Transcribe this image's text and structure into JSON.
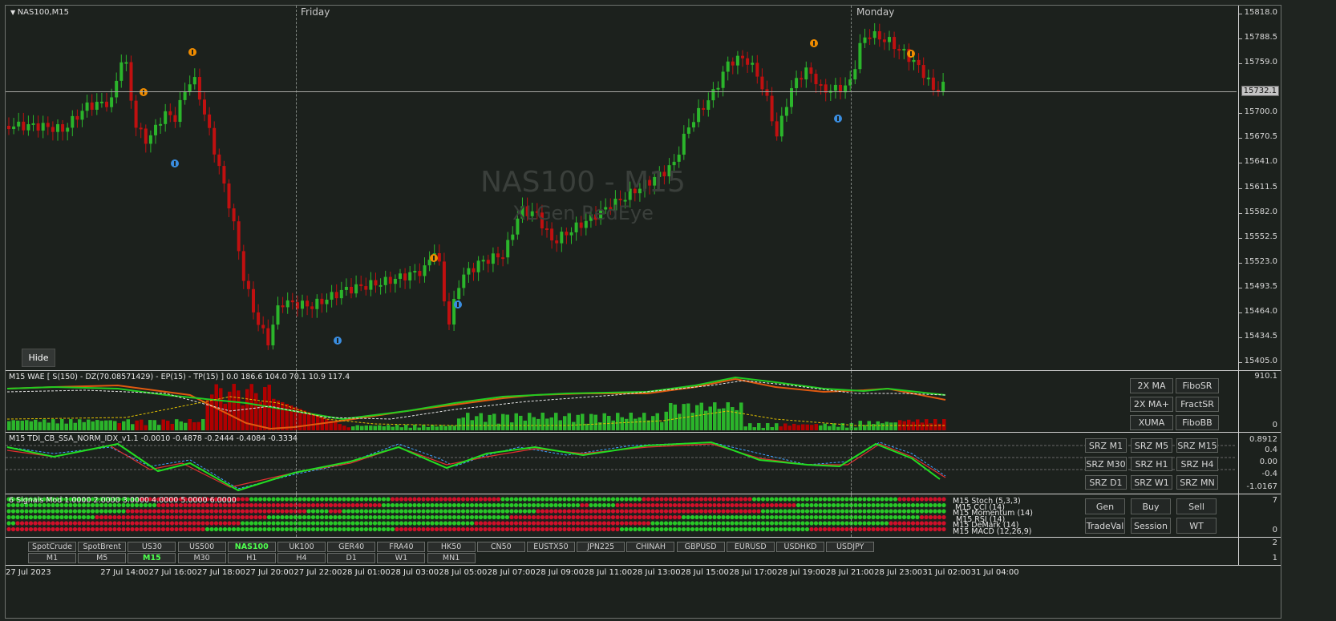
{
  "chart": {
    "symbol": "NAS100,M15",
    "watermark_title": "NAS100 - M15",
    "watermark_sub": "XLGen RedEye",
    "current_price": "15732.1",
    "price_ticks": [
      "15818.0",
      "15788.5",
      "15759.0",
      "15700.0",
      "15670.5",
      "15641.0",
      "15611.5",
      "15582.0",
      "15552.5",
      "15523.0",
      "15493.5",
      "15464.0",
      "15434.5",
      "15405.0"
    ],
    "day_labels": [
      "Friday",
      "Monday"
    ],
    "hide_label": "Hide",
    "colors": {
      "bull": "#2bb52b",
      "bear": "#c01010",
      "background": "#1c211d",
      "arrow_up": "#3a8de0",
      "arrow_down": "#f08c00"
    }
  },
  "wae": {
    "title": "M15 WAE [ S(150) - DZ(70.08571429) - EP(15) - TP(15) ] 0.0 186.6 104.0 70.1 10.9 117.4",
    "axis_top": "910.1",
    "axis_bottom": "0",
    "buttons": [
      "2X MA",
      "FiboSR",
      "2X MA+",
      "FractSR",
      "XUMA",
      "FiboBB"
    ]
  },
  "tdi": {
    "title": "M15  TDI_CB_SSA_NORM_IDX_v1.1  -0.0010 -0.4878 -0.2444 -0.4084 -0.3334",
    "axis": [
      "0.8912",
      "0.4",
      "0.00",
      "-0.4",
      "-1.0167"
    ],
    "buttons": [
      "SRZ M1",
      "SRZ M5",
      "SRZ M15",
      "SRZ M30",
      "SRZ H1",
      "SRZ H4",
      "SRZ D1",
      "SRZ W1",
      "SRZ MN"
    ]
  },
  "signals": {
    "title": "6 Signals Mod 1.0000 2.0000 3.0000 4.0000 5.0000 6.0000",
    "labels": [
      "M15 Stoch (5,3,3)",
      "M15 CCI (14)",
      "M15 Momentum (14)",
      "M15 RSI (14)",
      "M15 DeMark (14)",
      "M15 MACD (12,26,9)"
    ],
    "axis_top": "7",
    "axis_bottom": "0",
    "buttons": [
      "Gen",
      "Buy",
      "Sell",
      "TradeVal",
      "Session",
      "WT"
    ]
  },
  "selector": {
    "symbols": [
      "SpotCrude",
      "SpotBrent",
      "US30",
      "US500",
      "NAS100",
      "UK100",
      "GER40",
      "FRA40",
      "HK50",
      "CN50",
      "EUSTX50",
      "JPN225",
      "CHINAH",
      "GBPUSD",
      "EURUSD",
      "USDHKD",
      "USDJPY"
    ],
    "active_symbol": "NAS100",
    "timeframes": [
      "M1",
      "M5",
      "M15",
      "M30",
      "H1",
      "H4",
      "D1",
      "W1",
      "MN1"
    ],
    "active_timeframe": "M15",
    "axis": [
      "2",
      "1"
    ]
  },
  "time_axis": [
    "27 Jul 2023",
    "27 Jul 14:00",
    "27 Jul 16:00",
    "27 Jul 18:00",
    "27 Jul 20:00",
    "27 Jul 22:00",
    "28 Jul 01:00",
    "28 Jul 03:00",
    "28 Jul 05:00",
    "28 Jul 07:00",
    "28 Jul 09:00",
    "28 Jul 11:00",
    "28 Jul 13:00",
    "28 Jul 15:00",
    "28 Jul 17:00",
    "28 Jul 19:00",
    "28 Jul 21:00",
    "28 Jul 23:00",
    "31 Jul 02:00",
    "31 Jul 04:00"
  ]
}
